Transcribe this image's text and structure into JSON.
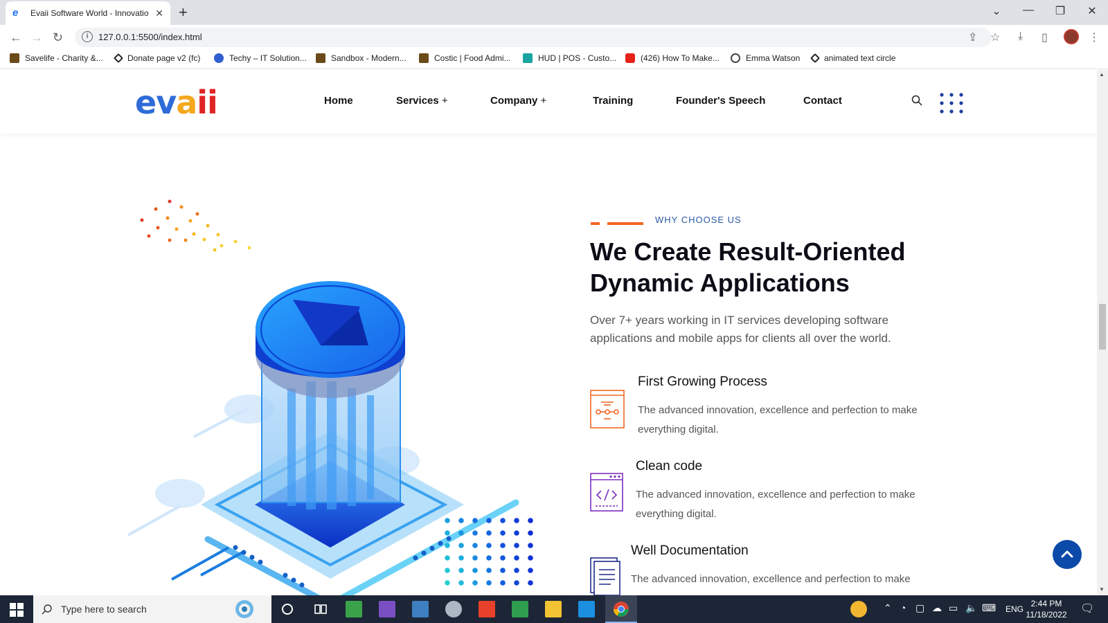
{
  "browser": {
    "tab_title": "Evaii Software World - Innovatio",
    "url": "127.0.0.1:5500/index.html",
    "bookmarks": [
      "Savelife - Charity &...",
      "Donate page v2 (fc)",
      "Techy – IT Solution...",
      "Sandbox - Modern...",
      "Costic | Food Admi...",
      "HUD | POS - Custo...",
      "(426) How To Make...",
      "Emma Watson",
      "animated text circle"
    ]
  },
  "site": {
    "logo": "evaii",
    "nav": {
      "home": "Home",
      "services": "Services",
      "company": "Company",
      "training": "Training",
      "founders_speech": "Founder's Speech",
      "contact": "Contact",
      "plus": "+"
    },
    "section": {
      "eyebrow": "WHY CHOOSE US",
      "heading": "We Create Result-Oriented Dynamic Applications",
      "lead": "Over 7+ years working in IT services developing software applications and mobile apps for clients all over the world.",
      "features": [
        {
          "title": "First Growing Process",
          "description": "The advanced innovation, excellence and perfection to make everything digital."
        },
        {
          "title": "Clean code",
          "description": "The advanced innovation, excellence and perfection to make everything digital."
        },
        {
          "title": "Well Documentation",
          "description": "The advanced innovation, excellence and perfection to make"
        }
      ]
    }
  },
  "taskbar": {
    "search_placeholder": "Type here to search",
    "language": "ENG",
    "time": "2:44 PM",
    "date": "11/18/2022"
  },
  "colors": {
    "accent_orange": "#f26522",
    "brand_blue": "#0b4aa8",
    "feature_purple": "#7b2fbf",
    "feature_navy": "#1e2a8a"
  }
}
